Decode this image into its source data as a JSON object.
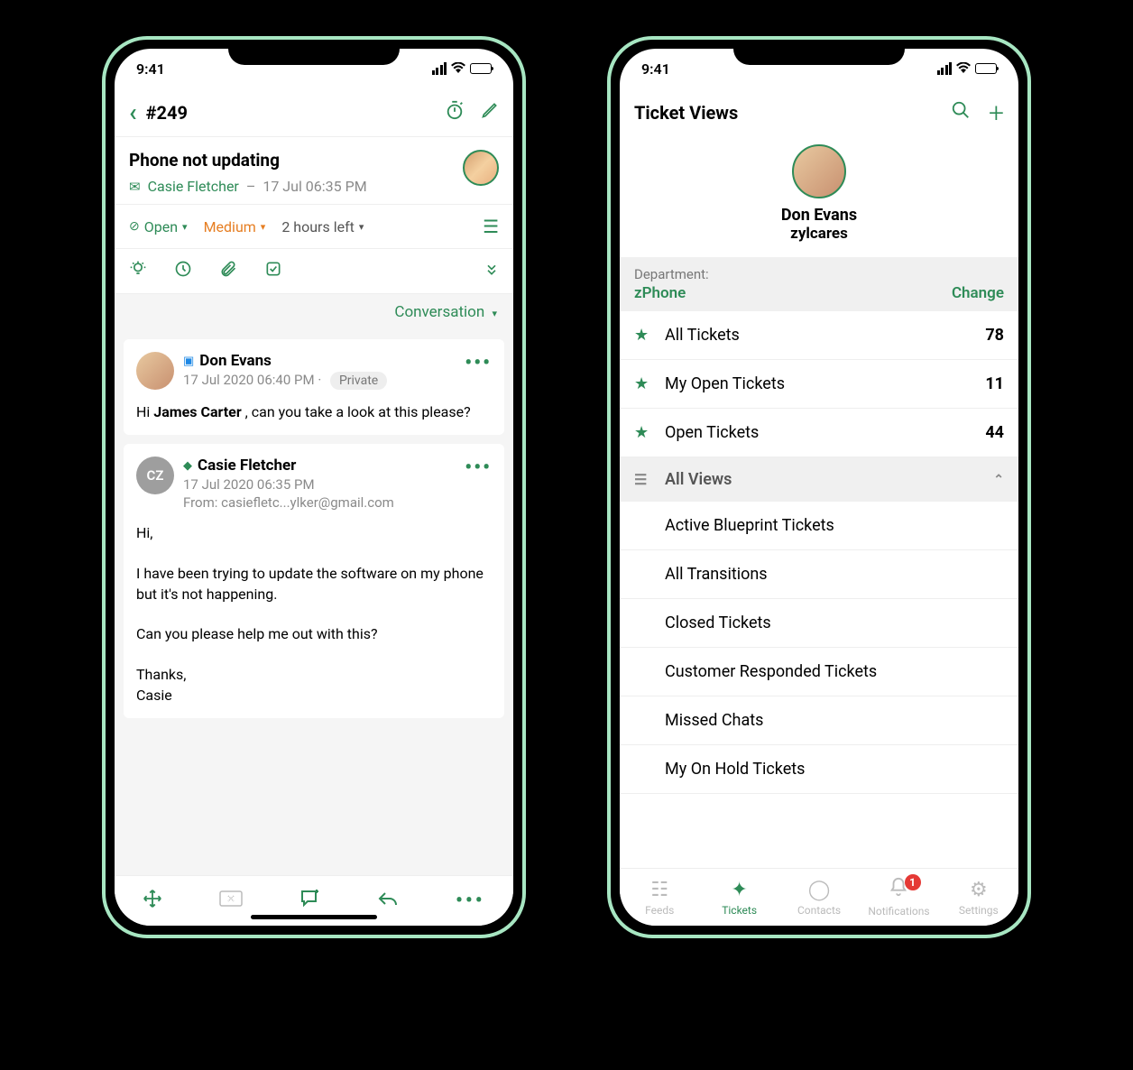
{
  "status_time": "9:41",
  "phone1": {
    "ticket_number": "#249",
    "subject": "Phone not updating",
    "requester": "Casie Fletcher",
    "requested_at": "17 Jul 06:35 PM",
    "status_open": "Open",
    "priority": "Medium",
    "due": "2 hours left",
    "conversation_label": "Conversation",
    "messages": [
      {
        "author": "Don Evans",
        "timestamp": "17 Jul 2020 06:40 PM",
        "visibility": "Private",
        "body_prefix": "Hi ",
        "body_bold": "James Carter",
        "body_suffix": " , can you take a look at this please?"
      },
      {
        "author": "Casie Fletcher",
        "avatar_initials": "CZ",
        "timestamp": "17 Jul 2020 06:35 PM",
        "from": "From: casiefletc...ylker@gmail.com",
        "body": "Hi,\n\nI have been trying to update the software on my phone but it's not happening.\n\nCan you please help me out with this?\n\nThanks,\nCasie"
      }
    ]
  },
  "phone2": {
    "header_title": "Ticket Views",
    "profile_name": "Don Evans",
    "profile_org": "zylcares",
    "department_label": "Department:",
    "department_value": "zPhone",
    "change_label": "Change",
    "starred_views": [
      {
        "label": "All Tickets",
        "count": "78"
      },
      {
        "label": "My Open Tickets",
        "count": "11"
      },
      {
        "label": "Open Tickets",
        "count": "44"
      }
    ],
    "all_views_label": "All Views",
    "all_views": [
      "Active Blueprint Tickets",
      "All Transitions",
      "Closed Tickets",
      "Customer Responded Tickets",
      "Missed Chats",
      "My On Hold Tickets"
    ],
    "tabs": {
      "feeds": "Feeds",
      "tickets": "Tickets",
      "contacts": "Contacts",
      "notifications": "Notifications",
      "settings": "Settings",
      "notif_count": "1"
    }
  }
}
